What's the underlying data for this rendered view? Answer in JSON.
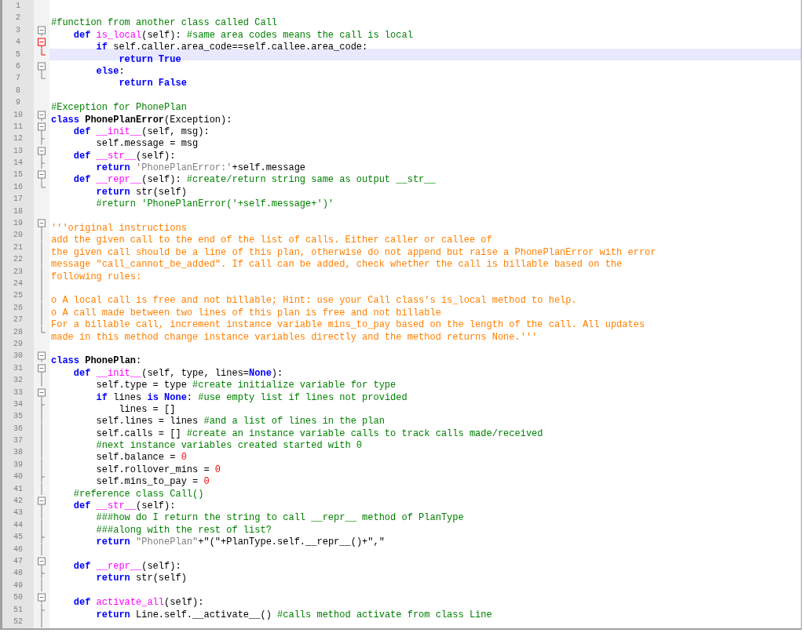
{
  "editor": {
    "lines": [
      {
        "number": "1",
        "selected": false
      },
      {
        "number": "2",
        "selected": false,
        "tokens": [
          {
            "text": "#function from another class called Call",
            "kind": "comment"
          }
        ]
      },
      {
        "number": "3",
        "fold": {
          "kind": "open",
          "active": false
        },
        "selected": false,
        "tokens": [
          {
            "text": "    def ",
            "kind": "keyword"
          },
          {
            "text": "is_local",
            "kind": "funcname"
          },
          {
            "text": "(self): ",
            "kind": "plain"
          },
          {
            "text": "#same area codes means the call is local",
            "kind": "comment"
          }
        ]
      },
      {
        "number": "4",
        "fold": {
          "kind": "open",
          "active": true
        },
        "selected": false,
        "tokens": [
          {
            "text": "        if",
            "kind": "keyword"
          },
          {
            "text": " self.caller.area_code==self.callee.area_code:",
            "kind": "plain"
          }
        ]
      },
      {
        "number": "5",
        "fold": {
          "kind": "end",
          "active": true
        },
        "selected": true,
        "tokens": [
          {
            "text": "            return True",
            "kind": "keyword"
          }
        ]
      },
      {
        "number": "6",
        "fold": {
          "kind": "open",
          "active": false
        },
        "selected": false,
        "tokens": [
          {
            "text": "        else",
            "kind": "keyword"
          },
          {
            "text": ":",
            "kind": "plain"
          }
        ]
      },
      {
        "number": "7",
        "fold": {
          "kind": "end",
          "active": false
        },
        "selected": false,
        "tokens": [
          {
            "text": "            return False",
            "kind": "keyword"
          }
        ]
      },
      {
        "number": "8",
        "selected": false
      },
      {
        "number": "9",
        "selected": false,
        "tokens": [
          {
            "text": "#Exception for PhonePlan",
            "kind": "comment"
          }
        ]
      },
      {
        "number": "10",
        "fold": {
          "kind": "open",
          "active": false
        },
        "selected": false,
        "tokens": [
          {
            "text": "class ",
            "kind": "keyword"
          },
          {
            "text": "PhonePlanError",
            "kind": "classname"
          },
          {
            "text": "(Exception):",
            "kind": "plain"
          }
        ]
      },
      {
        "number": "11",
        "fold": {
          "kind": "open",
          "active": false
        },
        "selected": false,
        "tokens": [
          {
            "text": "    def ",
            "kind": "keyword"
          },
          {
            "text": "__init__",
            "kind": "funcname"
          },
          {
            "text": "(self, msg):",
            "kind": "plain"
          }
        ]
      },
      {
        "number": "12",
        "fold": {
          "kind": "tee",
          "active": false
        },
        "selected": false,
        "tokens": [
          {
            "text": "        self.message = msg",
            "kind": "plain"
          }
        ]
      },
      {
        "number": "13",
        "fold": {
          "kind": "open",
          "active": false
        },
        "selected": false,
        "tokens": [
          {
            "text": "    def ",
            "kind": "keyword"
          },
          {
            "text": "__str__",
            "kind": "funcname"
          },
          {
            "text": "(self):",
            "kind": "plain"
          }
        ]
      },
      {
        "number": "14",
        "fold": {
          "kind": "tee",
          "active": false
        },
        "selected": false,
        "tokens": [
          {
            "text": "        return ",
            "kind": "keyword"
          },
          {
            "text": "'PhonePlanError:'",
            "kind": "string"
          },
          {
            "text": "+self.message",
            "kind": "plain"
          }
        ]
      },
      {
        "number": "15",
        "fold": {
          "kind": "open",
          "active": false
        },
        "selected": false,
        "tokens": [
          {
            "text": "    def ",
            "kind": "keyword"
          },
          {
            "text": "__repr__",
            "kind": "funcname"
          },
          {
            "text": "(self): ",
            "kind": "plain"
          },
          {
            "text": "#create/return string same as output __str__",
            "kind": "comment"
          }
        ]
      },
      {
        "number": "16",
        "fold": {
          "kind": "end",
          "active": false
        },
        "selected": false,
        "tokens": [
          {
            "text": "        return",
            "kind": "keyword"
          },
          {
            "text": " str(self)",
            "kind": "plain"
          }
        ]
      },
      {
        "number": "17",
        "selected": false,
        "tokens": [
          {
            "text": "        #return 'PhonePlanError('+self.message+')'",
            "kind": "comment"
          }
        ]
      },
      {
        "number": "18",
        "selected": false
      },
      {
        "number": "19",
        "fold": {
          "kind": "open",
          "active": false
        },
        "selected": false,
        "tokens": [
          {
            "text": "'''original instructions",
            "kind": "docstring"
          }
        ]
      },
      {
        "number": "20",
        "fold": {
          "kind": "line",
          "active": false
        },
        "selected": false,
        "tokens": [
          {
            "text": "add the given call to the end of the list of calls. Either caller or callee of",
            "kind": "docstring"
          }
        ]
      },
      {
        "number": "21",
        "fold": {
          "kind": "line",
          "active": false
        },
        "selected": false,
        "tokens": [
          {
            "text": "the given call should be a line of this plan, otherwise do not append but raise a PhonePlanError with error",
            "kind": "docstring"
          }
        ]
      },
      {
        "number": "22",
        "fold": {
          "kind": "line",
          "active": false
        },
        "selected": false,
        "tokens": [
          {
            "text": "message \"call_cannot_be_added\". If call can be added, check whether the call is billable based on the",
            "kind": "docstring"
          }
        ]
      },
      {
        "number": "23",
        "fold": {
          "kind": "line",
          "active": false
        },
        "selected": false,
        "tokens": [
          {
            "text": "following rules:",
            "kind": "docstring"
          }
        ]
      },
      {
        "number": "24",
        "fold": {
          "kind": "line",
          "active": false
        },
        "selected": false
      },
      {
        "number": "25",
        "fold": {
          "kind": "line",
          "active": false
        },
        "selected": false,
        "tokens": [
          {
            "text": "o A local call is free and not billable; Hint: use your Call class's is_local method to help.",
            "kind": "docstring"
          }
        ]
      },
      {
        "number": "26",
        "fold": {
          "kind": "line",
          "active": false
        },
        "selected": false,
        "tokens": [
          {
            "text": "o A call made between two lines of this plan is free and not billable",
            "kind": "docstring"
          }
        ]
      },
      {
        "number": "27",
        "fold": {
          "kind": "line",
          "active": false
        },
        "selected": false,
        "tokens": [
          {
            "text": "For a billable call, increment instance variable mins_to_pay based on the length of the call. All updates",
            "kind": "docstring"
          }
        ]
      },
      {
        "number": "28",
        "fold": {
          "kind": "end",
          "active": false
        },
        "selected": false,
        "tokens": [
          {
            "text": "made in this method change instance variables directly and the method returns None.'''",
            "kind": "docstring"
          }
        ]
      },
      {
        "number": "29",
        "selected": false
      },
      {
        "number": "30",
        "fold": {
          "kind": "open",
          "active": false
        },
        "selected": false,
        "tokens": [
          {
            "text": "class ",
            "kind": "keyword"
          },
          {
            "text": "PhonePlan",
            "kind": "classname"
          },
          {
            "text": ":",
            "kind": "plain"
          }
        ]
      },
      {
        "number": "31",
        "fold": {
          "kind": "open",
          "active": false
        },
        "selected": false,
        "tokens": [
          {
            "text": "    def ",
            "kind": "keyword"
          },
          {
            "text": "__init__",
            "kind": "funcname"
          },
          {
            "text": "(self, type, lines=",
            "kind": "plain"
          },
          {
            "text": "None",
            "kind": "keyword"
          },
          {
            "text": "):",
            "kind": "plain"
          }
        ]
      },
      {
        "number": "32",
        "fold": {
          "kind": "line",
          "active": false
        },
        "selected": false,
        "tokens": [
          {
            "text": "        self.type = type ",
            "kind": "plain"
          },
          {
            "text": "#create initialize variable for type",
            "kind": "comment"
          }
        ]
      },
      {
        "number": "33",
        "fold": {
          "kind": "open",
          "active": false
        },
        "selected": false,
        "tokens": [
          {
            "text": "        if",
            "kind": "keyword"
          },
          {
            "text": " lines ",
            "kind": "plain"
          },
          {
            "text": "is None",
            "kind": "keyword"
          },
          {
            "text": ": ",
            "kind": "plain"
          },
          {
            "text": "#use empty list if lines not provided",
            "kind": "comment"
          }
        ]
      },
      {
        "number": "34",
        "fold": {
          "kind": "tee",
          "active": false
        },
        "selected": false,
        "tokens": [
          {
            "text": "            lines = []",
            "kind": "plain"
          }
        ]
      },
      {
        "number": "35",
        "fold": {
          "kind": "line",
          "active": false
        },
        "selected": false,
        "tokens": [
          {
            "text": "        self.lines = lines ",
            "kind": "plain"
          },
          {
            "text": "#and a list of lines in the plan",
            "kind": "comment"
          }
        ]
      },
      {
        "number": "36",
        "fold": {
          "kind": "line",
          "active": false
        },
        "selected": false,
        "tokens": [
          {
            "text": "        self.calls = [] ",
            "kind": "plain"
          },
          {
            "text": "#create an instance variable calls to track calls made/received",
            "kind": "comment"
          }
        ]
      },
      {
        "number": "37",
        "fold": {
          "kind": "line",
          "active": false
        },
        "selected": false,
        "tokens": [
          {
            "text": "        #next instance variables created started with 0",
            "kind": "comment"
          }
        ]
      },
      {
        "number": "38",
        "fold": {
          "kind": "line",
          "active": false
        },
        "selected": false,
        "tokens": [
          {
            "text": "        self.balance = ",
            "kind": "plain"
          },
          {
            "text": "0",
            "kind": "number"
          }
        ]
      },
      {
        "number": "39",
        "fold": {
          "kind": "line",
          "active": false
        },
        "selected": false,
        "tokens": [
          {
            "text": "        self.rollover_mins = ",
            "kind": "plain"
          },
          {
            "text": "0",
            "kind": "number"
          }
        ]
      },
      {
        "number": "40",
        "fold": {
          "kind": "tee",
          "active": false
        },
        "selected": false,
        "tokens": [
          {
            "text": "        self.mins_to_pay = ",
            "kind": "plain"
          },
          {
            "text": "0",
            "kind": "number"
          }
        ]
      },
      {
        "number": "41",
        "fold": {
          "kind": "line",
          "active": false
        },
        "selected": false,
        "tokens": [
          {
            "text": "    #reference class Call()",
            "kind": "comment"
          }
        ]
      },
      {
        "number": "42",
        "fold": {
          "kind": "open",
          "active": false
        },
        "selected": false,
        "tokens": [
          {
            "text": "    def ",
            "kind": "keyword"
          },
          {
            "text": "__str__",
            "kind": "funcname"
          },
          {
            "text": "(self):",
            "kind": "plain"
          }
        ]
      },
      {
        "number": "43",
        "fold": {
          "kind": "line",
          "active": false
        },
        "selected": false,
        "tokens": [
          {
            "text": "        ###how do I return the string to call __repr__ method of PlanType",
            "kind": "comment"
          }
        ]
      },
      {
        "number": "44",
        "fold": {
          "kind": "line",
          "active": false
        },
        "selected": false,
        "tokens": [
          {
            "text": "        ###along with the rest of list?",
            "kind": "comment"
          }
        ]
      },
      {
        "number": "45",
        "fold": {
          "kind": "tee",
          "active": false
        },
        "selected": false,
        "tokens": [
          {
            "text": "        return ",
            "kind": "keyword"
          },
          {
            "text": "\"PhonePlan\"",
            "kind": "string"
          },
          {
            "text": "+\"(\"+PlanType.self.__repr__()+\",\"",
            "kind": "plain"
          }
        ]
      },
      {
        "number": "46",
        "fold": {
          "kind": "line",
          "active": false
        },
        "selected": false
      },
      {
        "number": "47",
        "fold": {
          "kind": "open",
          "active": false
        },
        "selected": false,
        "tokens": [
          {
            "text": "    def ",
            "kind": "keyword"
          },
          {
            "text": "__repr__",
            "kind": "funcname"
          },
          {
            "text": "(self):",
            "kind": "plain"
          }
        ]
      },
      {
        "number": "48",
        "fold": {
          "kind": "tee",
          "active": false
        },
        "selected": false,
        "tokens": [
          {
            "text": "        return",
            "kind": "keyword"
          },
          {
            "text": " str(self)",
            "kind": "plain"
          }
        ]
      },
      {
        "number": "49",
        "fold": {
          "kind": "line",
          "active": false
        },
        "selected": false
      },
      {
        "number": "50",
        "fold": {
          "kind": "open",
          "active": false
        },
        "selected": false,
        "tokens": [
          {
            "text": "    def ",
            "kind": "keyword"
          },
          {
            "text": "activate_all",
            "kind": "funcname"
          },
          {
            "text": "(self):",
            "kind": "plain"
          }
        ]
      },
      {
        "number": "51",
        "fold": {
          "kind": "tee",
          "active": false
        },
        "selected": false,
        "tokens": [
          {
            "text": "        return",
            "kind": "keyword"
          },
          {
            "text": " Line.self.__activate__() ",
            "kind": "plain"
          },
          {
            "text": "#calls method activate from class Line",
            "kind": "comment"
          }
        ]
      },
      {
        "number": "52",
        "fold": {
          "kind": "line",
          "active": false
        },
        "selected": false
      }
    ]
  }
}
